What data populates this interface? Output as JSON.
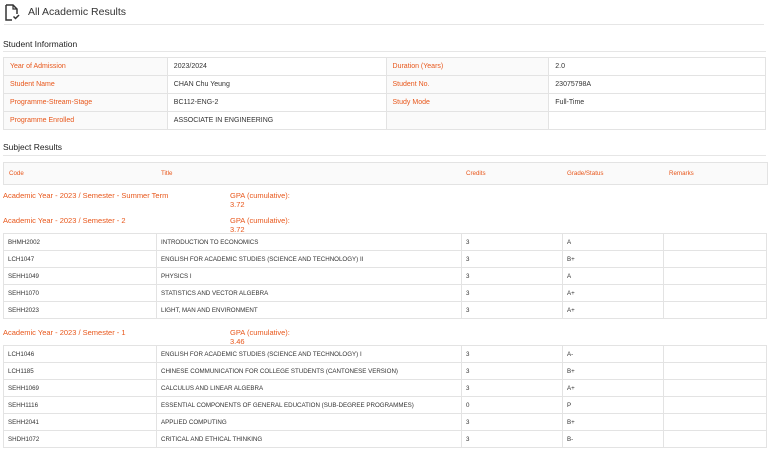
{
  "page": {
    "title": "All Academic Results"
  },
  "student_info": {
    "title": "Student Information",
    "rows": [
      {
        "l1": "Year of Admission",
        "v1": "2023/2024",
        "l2": "Duration (Years)",
        "v2": "2.0"
      },
      {
        "l1": "Student Name",
        "v1": "CHAN Chu Yeung",
        "l2": "Student No.",
        "v2": "23075798A"
      },
      {
        "l1": "Programme-Stream-Stage",
        "v1": "BC112-ENG-2",
        "l2": "Study Mode",
        "v2": "Full-Time"
      },
      {
        "l1": "Programme Enrolled",
        "v1": "ASSOCIATE IN ENGINEERING",
        "l2": "",
        "v2": ""
      }
    ]
  },
  "subject_results": {
    "title": "Subject Results",
    "headers": {
      "code": "Code",
      "title": "Title",
      "credits": "Credits",
      "grade": "Grade/Status",
      "remarks": "Remarks"
    },
    "semesters": [
      {
        "name": "Academic Year - 2023 / Semester - Summer Term",
        "gpa": "GPA (cumulative): 3.72",
        "rows": []
      },
      {
        "name": "Academic Year - 2023 / Semester - 2",
        "gpa": "GPA (cumulative): 3.72",
        "rows": [
          {
            "code": "BHMH2002",
            "title": "INTRODUCTION TO ECONOMICS",
            "credits": "3",
            "grade": "A",
            "remarks": ""
          },
          {
            "code": "LCH1047",
            "title": "ENGLISH FOR ACADEMIC STUDIES (SCIENCE AND TECHNOLOGY) II",
            "credits": "3",
            "grade": "B+",
            "remarks": ""
          },
          {
            "code": "SEHH1049",
            "title": "PHYSICS I",
            "credits": "3",
            "grade": "A",
            "remarks": ""
          },
          {
            "code": "SEHH1070",
            "title": "STATISTICS AND VECTOR ALGEBRA",
            "credits": "3",
            "grade": "A+",
            "remarks": ""
          },
          {
            "code": "SEHH2023",
            "title": "LIGHT, MAN AND ENVIRONMENT",
            "credits": "3",
            "grade": "A+",
            "remarks": ""
          }
        ]
      },
      {
        "name": "Academic Year - 2023 / Semester - 1",
        "gpa": "GPA (cumulative): 3.46",
        "rows": [
          {
            "code": "LCH1046",
            "title": "ENGLISH FOR ACADEMIC STUDIES (SCIENCE AND TECHNOLOGY) I",
            "credits": "3",
            "grade": "A-",
            "remarks": ""
          },
          {
            "code": "LCH1185",
            "title": "CHINESE COMMUNICATION FOR COLLEGE STUDENTS (CANTONESE VERSION)",
            "credits": "3",
            "grade": "B+",
            "remarks": ""
          },
          {
            "code": "SEHH1069",
            "title": "CALCULUS AND LINEAR ALGEBRA",
            "credits": "3",
            "grade": "A+",
            "remarks": ""
          },
          {
            "code": "SEHH1116",
            "title": "ESSENTIAL COMPONENTS OF GENERAL EDUCATION (SUB-DEGREE PROGRAMMES)",
            "credits": "0",
            "grade": "P",
            "remarks": ""
          },
          {
            "code": "SEHH2041",
            "title": "APPLIED COMPUTING",
            "credits": "3",
            "grade": "B+",
            "remarks": ""
          },
          {
            "code": "SHDH1072",
            "title": "CRITICAL AND ETHICAL THINKING",
            "credits": "3",
            "grade": "B-",
            "remarks": ""
          }
        ]
      }
    ]
  }
}
